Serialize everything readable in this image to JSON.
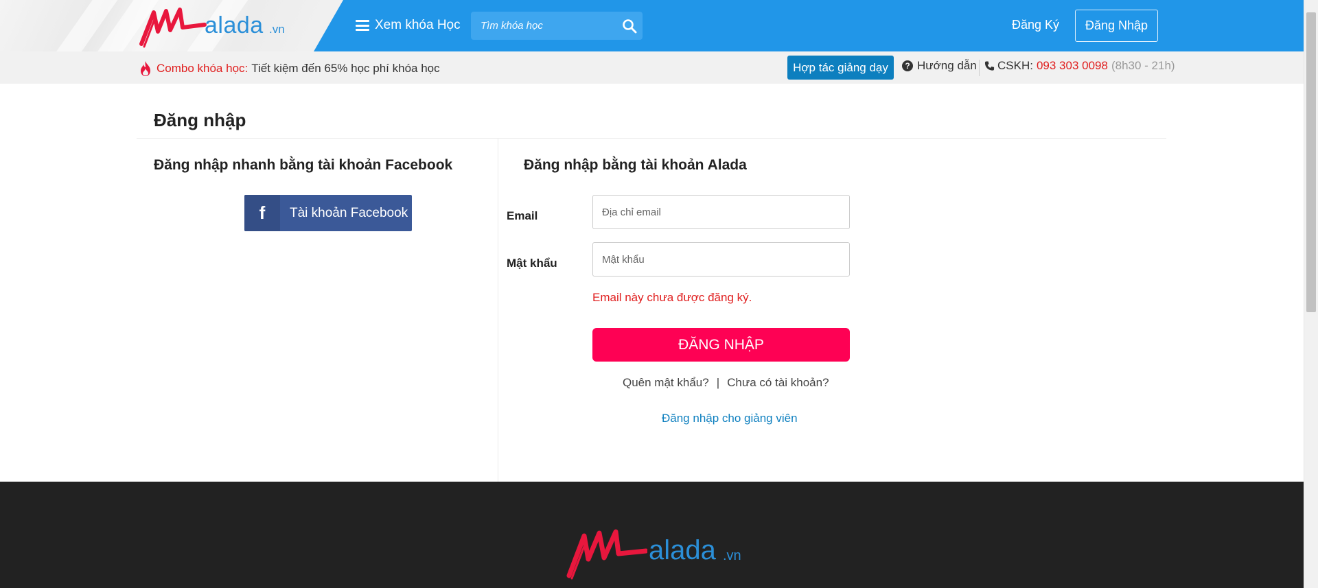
{
  "header": {
    "logo": {
      "word": "alada",
      "tld": ".vn"
    },
    "menu_label": "Xem khóa Học",
    "search": {
      "placeholder": "Tìm khóa học"
    },
    "register_label": "Đăng Ký",
    "login_label": "Đăng Nhập"
  },
  "subbar": {
    "promo_label": "Combo khóa học:",
    "promo_text": "Tiết kiệm đến 65% học phí khóa học",
    "coop_label": "Hợp tác giảng dạy",
    "guide_label": "Hướng dẫn",
    "cskh_label": "CSKH:",
    "phone": "093 303 0098",
    "hours": "(8h30 - 21h)"
  },
  "main": {
    "page_title": "Đăng nhập",
    "facebook": {
      "title": "Đăng nhập nhanh bằng tài khoản Facebook",
      "button_label": "Tài khoản Facebook",
      "icon_glyph": "f"
    },
    "alada": {
      "title": "Đăng nhập bằng tài khoản Alada",
      "email_label": "Email",
      "email_placeholder": "Địa chỉ email",
      "password_label": "Mật khẩu",
      "password_placeholder": "Mật khẩu",
      "error": "Email này chưa được đăng ký.",
      "submit_label": "ĐĂNG NHẬP",
      "forgot_label": "Quên mật khẩu?",
      "separator": "|",
      "no_account_label": "Chưa có tài khoản?",
      "teacher_login_label": "Đăng nhập cho giảng viên"
    }
  },
  "footer": {
    "logo": {
      "word": "alada",
      "tld": ".vn"
    }
  },
  "colors": {
    "header_blue": "#2196e8",
    "accent_red": "#e01e1e",
    "submit_pink": "#fe0154",
    "facebook_blue": "#3b5998",
    "link_blue": "#0d7fbf",
    "footer_dark": "#222222"
  }
}
